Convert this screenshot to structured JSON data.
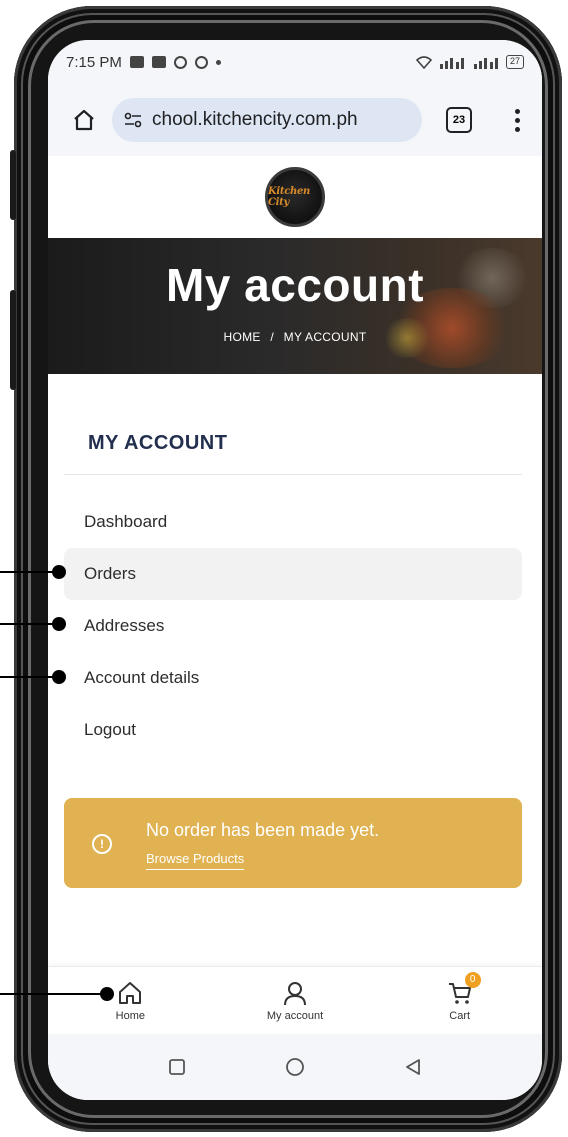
{
  "status_bar": {
    "time": "7:15 PM",
    "battery": "27"
  },
  "browser": {
    "url": "chool.kitchencity.com.ph",
    "tab_count": "23"
  },
  "site": {
    "logo_text": "Kitchen City"
  },
  "hero": {
    "title": "My account",
    "breadcrumb_home": "HOME",
    "breadcrumb_separator": "/",
    "breadcrumb_current": "MY ACCOUNT"
  },
  "account": {
    "heading": "MY ACCOUNT",
    "nav": [
      {
        "label": "Dashboard"
      },
      {
        "label": "Orders"
      },
      {
        "label": "Addresses"
      },
      {
        "label": "Account details"
      },
      {
        "label": "Logout"
      }
    ],
    "active_index": 1
  },
  "notice": {
    "message": "No order has been made yet.",
    "link": "Browse Products",
    "color": "#e0b252"
  },
  "bottom_nav": {
    "home": "Home",
    "my_account": "My account",
    "cart": "Cart",
    "cart_count": "0"
  },
  "colors": {
    "accent": "#e0b252",
    "heading": "#232f4e",
    "badge": "#f0a020"
  }
}
